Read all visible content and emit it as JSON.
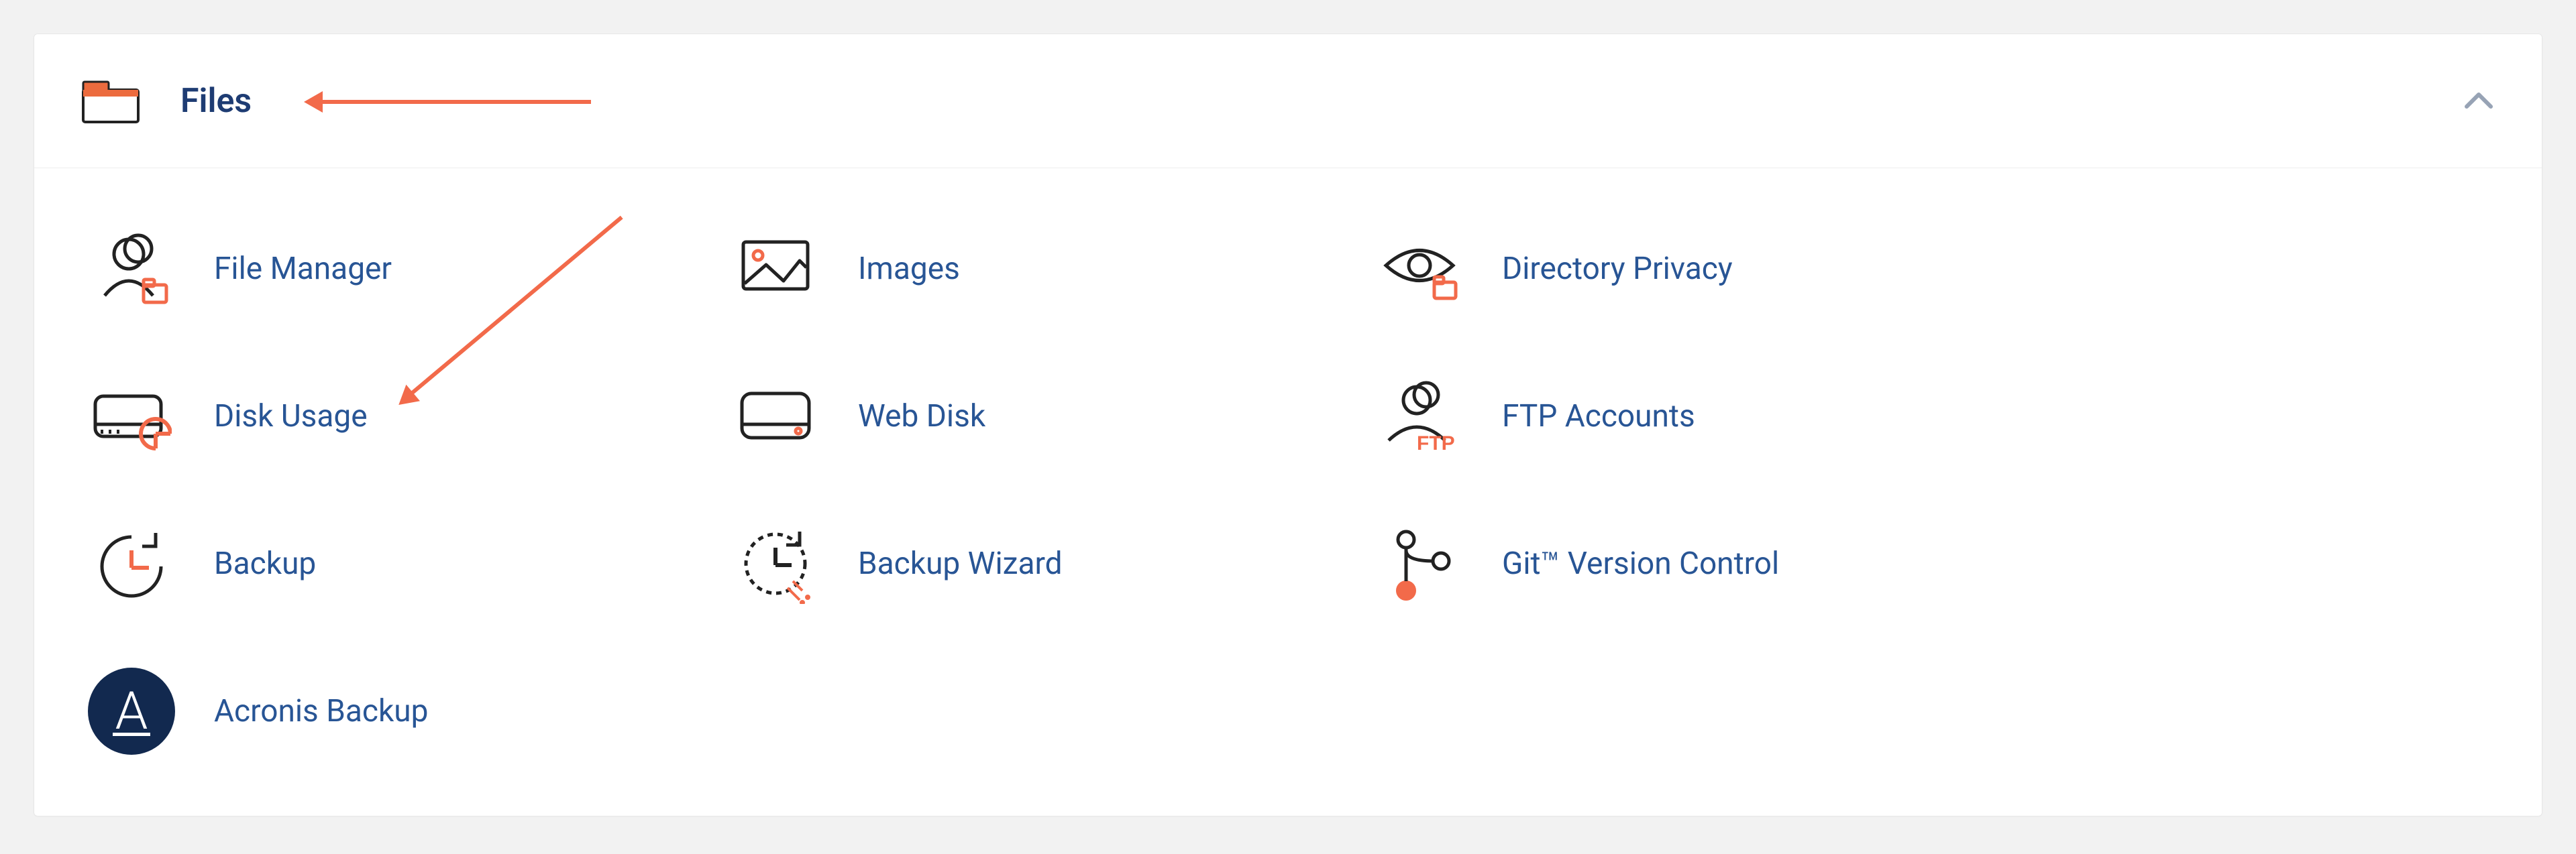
{
  "section": {
    "title": "Files"
  },
  "items": [
    {
      "slug": "file-manager",
      "label": "File Manager"
    },
    {
      "slug": "images",
      "label": "Images"
    },
    {
      "slug": "directory-privacy",
      "label": "Directory Privacy"
    },
    {
      "slug": "disk-usage",
      "label": "Disk Usage"
    },
    {
      "slug": "web-disk",
      "label": "Web Disk"
    },
    {
      "slug": "ftp-accounts",
      "label": "FTP Accounts"
    },
    {
      "slug": "backup",
      "label": "Backup"
    },
    {
      "slug": "backup-wizard",
      "label": "Backup Wizard"
    },
    {
      "slug": "git",
      "label": "Git™ Version Control"
    },
    {
      "slug": "acronis",
      "label": "Acronis Backup"
    }
  ],
  "colors": {
    "accent": "#f26a4a",
    "label": "#285595",
    "title": "#1e3c73",
    "acronis": "#12294f",
    "mute": "#97a3b5"
  }
}
